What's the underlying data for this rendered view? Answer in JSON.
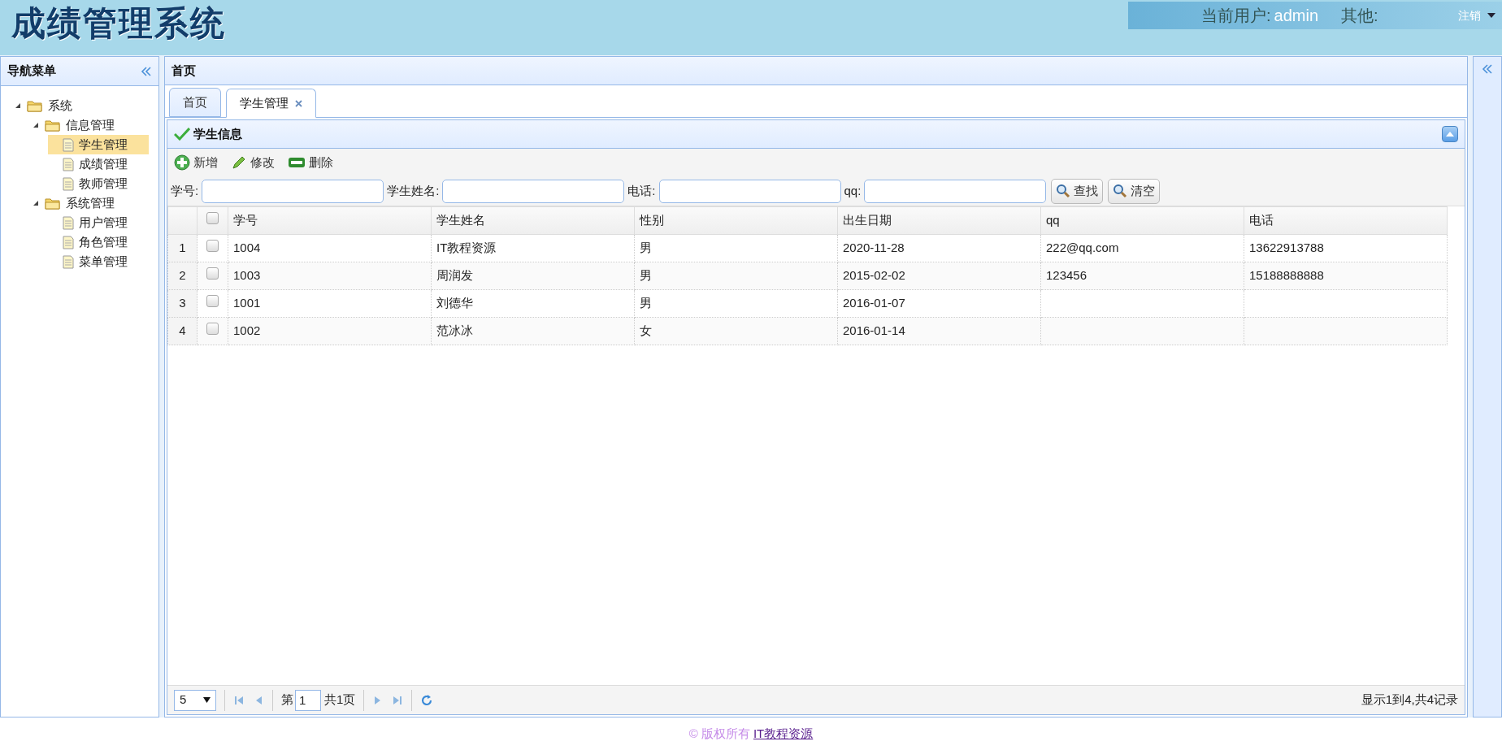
{
  "header": {
    "logo": "成绩管理系统",
    "user_label": "当前用户:",
    "user": "admin",
    "other_label": "其他:",
    "logout": "注销"
  },
  "sidebar": {
    "title": "导航菜单",
    "tree": [
      {
        "label": "系统",
        "kind": "folder",
        "expanded": true,
        "selected": false,
        "children": [
          {
            "label": "信息管理",
            "kind": "folder",
            "expanded": true,
            "selected": false,
            "children": [
              {
                "label": "学生管理",
                "kind": "file",
                "selected": true
              },
              {
                "label": "成绩管理",
                "kind": "file",
                "selected": false
              },
              {
                "label": "教师管理",
                "kind": "file",
                "selected": false
              }
            ]
          },
          {
            "label": "系统管理",
            "kind": "folder",
            "expanded": true,
            "selected": false,
            "children": [
              {
                "label": "用户管理",
                "kind": "file",
                "selected": false
              },
              {
                "label": "角色管理",
                "kind": "file",
                "selected": false
              },
              {
                "label": "菜单管理",
                "kind": "file",
                "selected": false
              }
            ]
          }
        ]
      }
    ]
  },
  "main": {
    "title": "首页",
    "tabs": [
      {
        "label": "首页",
        "selected": false,
        "closable": false
      },
      {
        "label": "学生管理",
        "selected": true,
        "closable": true
      }
    ],
    "panel_title": "学生信息",
    "toolbar": [
      {
        "label": "新增",
        "kind": "add"
      },
      {
        "label": "修改",
        "kind": "edit"
      },
      {
        "label": "删除",
        "kind": "delete"
      }
    ],
    "search": {
      "fields": [
        {
          "label": "学号:"
        },
        {
          "label": "学生姓名:"
        },
        {
          "label": "电话:"
        },
        {
          "label": "qq:"
        }
      ],
      "buttons": [
        "查找",
        "清空"
      ]
    },
    "table": {
      "columns": [
        "学号",
        "学生姓名",
        "性别",
        "出生日期",
        "qq",
        "电话"
      ],
      "header_checked": false,
      "rows": [
        {
          "number": "1",
          "checked": false,
          "cells": [
            "1004",
            "IT教程资源",
            "男",
            "2020-11-28",
            "222@qq.com",
            "13622913788"
          ]
        },
        {
          "number": "2",
          "checked": false,
          "cells": [
            "1003",
            "周润发",
            "男",
            "2015-02-02",
            "123456",
            "15188888888"
          ]
        },
        {
          "number": "3",
          "checked": false,
          "cells": [
            "1001",
            "刘德华",
            "男",
            "2016-01-07",
            "",
            ""
          ]
        },
        {
          "number": "4",
          "checked": false,
          "cells": [
            "1002",
            "范冰冰",
            "女",
            "2016-01-14",
            "",
            ""
          ]
        }
      ]
    },
    "pager": {
      "page_size": "5",
      "page_prefix": "第",
      "page": "1",
      "page_total": "共1页",
      "info": "显示1到4,共4记录"
    }
  },
  "footer": {
    "copyright": "© 版权所有",
    "link": "IT教程资源"
  }
}
